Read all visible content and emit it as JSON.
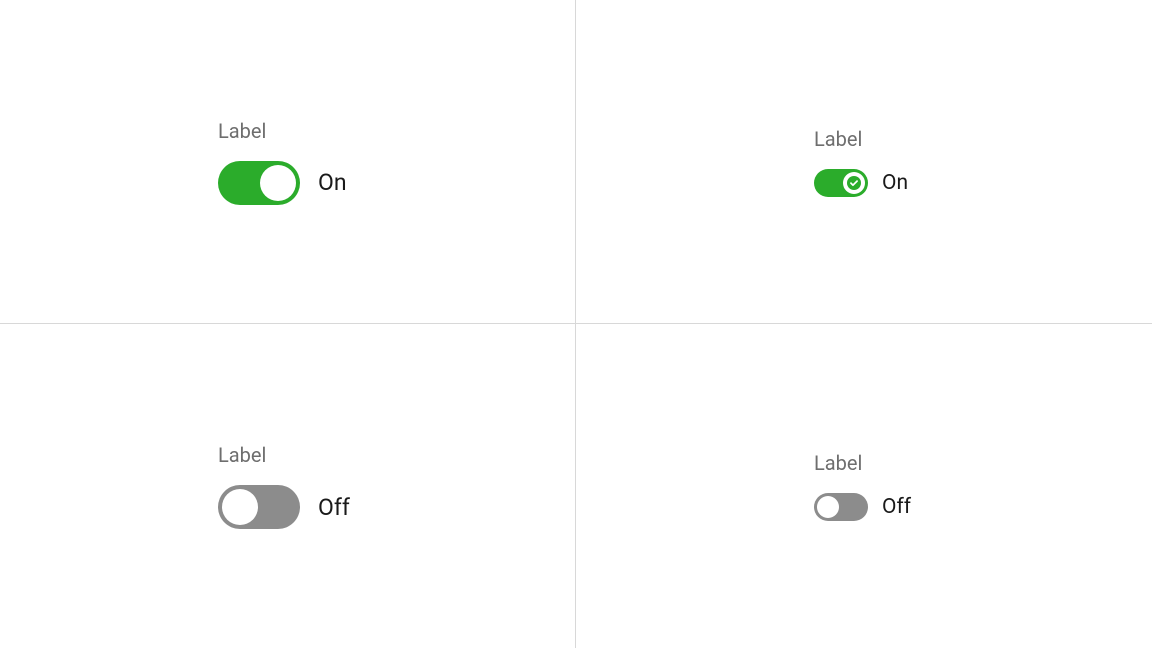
{
  "toggles": {
    "topLeft": {
      "label": "Label",
      "state": "On"
    },
    "topRight": {
      "label": "Label",
      "state": "On"
    },
    "bottomLeft": {
      "label": "Label",
      "state": "Off"
    },
    "bottomRight": {
      "label": "Label",
      "state": "Off"
    }
  },
  "colors": {
    "on": "#2bac2b",
    "off": "#8c8c8c"
  }
}
